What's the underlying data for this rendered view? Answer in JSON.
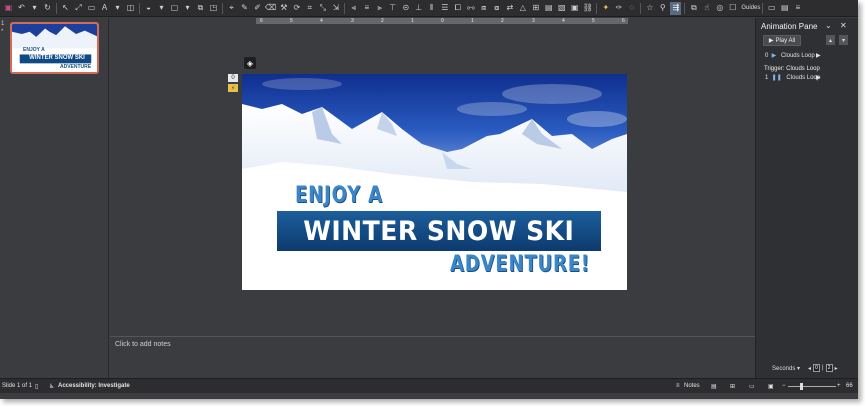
{
  "toolbar": {
    "guides_label": "Guides"
  },
  "thumbnails": {
    "slide_number": "1",
    "star": "*",
    "thumb_line1": "ENJOY A",
    "thumb_line2": "WINTER SNOW SKI",
    "thumb_line3": "ADVENTURE"
  },
  "ruler": {
    "ticks": [
      "6",
      "5",
      "4",
      "3",
      "2",
      "1",
      "0",
      "1",
      "2",
      "3",
      "4",
      "5",
      "6"
    ]
  },
  "slide": {
    "line1": "ENJOY A",
    "line2": "WINTER SNOW SKI",
    "line3": "ADVENTURE!",
    "anim_tag_0": "0",
    "anim_tag_1": "1"
  },
  "notes": {
    "placeholder": "Click to add notes"
  },
  "animation_pane": {
    "title": "Animation Pane",
    "play_all": "Play All",
    "items": [
      {
        "index": "0",
        "label": "Clouds Loop"
      },
      {
        "index": "1",
        "label": "Clouds Loop"
      }
    ],
    "trigger_label": "Trigger: Clouds Loop",
    "seconds_label": "Seconds",
    "zoom_from": "0",
    "zoom_to": "2"
  },
  "status_bar": {
    "slide_info": "Slide 1 of 1",
    "accessibility": "Accessibility: Investigate",
    "notes": "Notes",
    "zoom": "66"
  },
  "colors": {
    "sky": "#1a3f9c",
    "banner": "#0f4a86",
    "title_blue": "#3a86c8",
    "thumb_border": "#d36b5a"
  }
}
